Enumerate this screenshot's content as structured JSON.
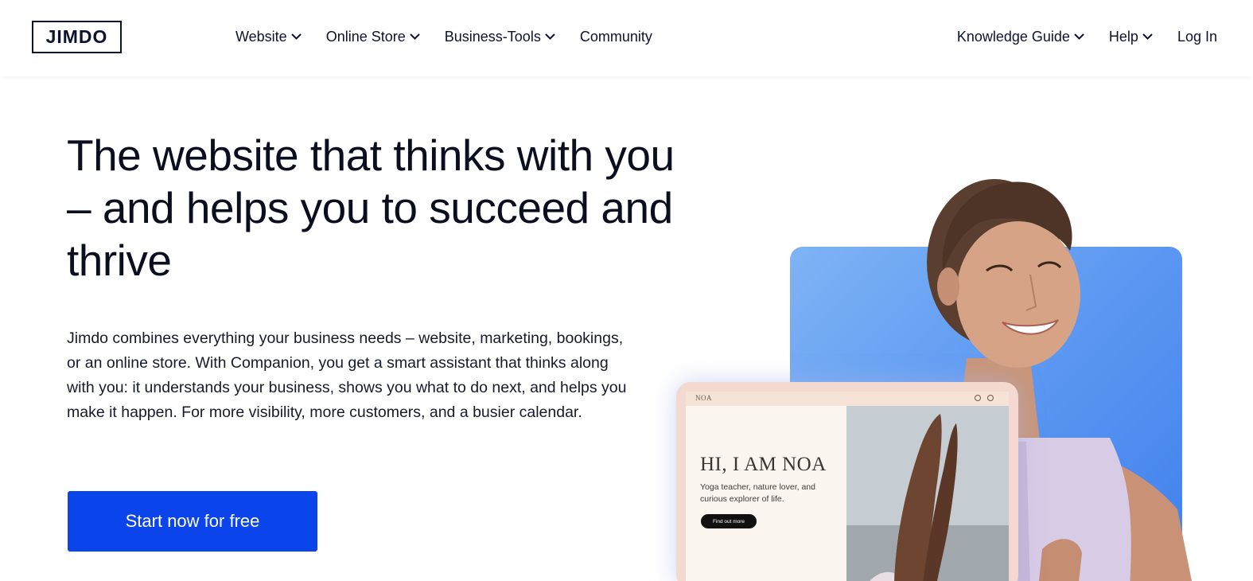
{
  "header": {
    "logo_text": "JIMDO",
    "nav_left": [
      {
        "label": "Website",
        "has_dropdown": true
      },
      {
        "label": "Online Store",
        "has_dropdown": true
      },
      {
        "label": "Business-Tools",
        "has_dropdown": true
      },
      {
        "label": "Community",
        "has_dropdown": false
      }
    ],
    "nav_right": [
      {
        "label": "Knowledge Guide",
        "has_dropdown": true
      },
      {
        "label": "Help",
        "has_dropdown": true
      },
      {
        "label": "Log In",
        "has_dropdown": false
      }
    ]
  },
  "hero": {
    "title": "The website that thinks with you – and helps you to succeed and thrive",
    "description": "Jimdo combines everything your business needs – website, marketing, bookings, or an online store. With Companion, you get a smart assistant that thinks along with you: it understands your business, shows you what to do next, and helps you make it happen. For more visibility, more customers, and a busier calendar.",
    "cta_label": "Start now for free"
  },
  "mockup": {
    "brand": "NOA",
    "heading": "HI, I AM NOA",
    "text": "Yoga teacher, nature lover, and curious explorer of life.",
    "button_label": "Find out more"
  },
  "colors": {
    "text_dark": "#0c1230",
    "cta_blue": "#0a44ea",
    "card_blue": "#5c98f2"
  }
}
